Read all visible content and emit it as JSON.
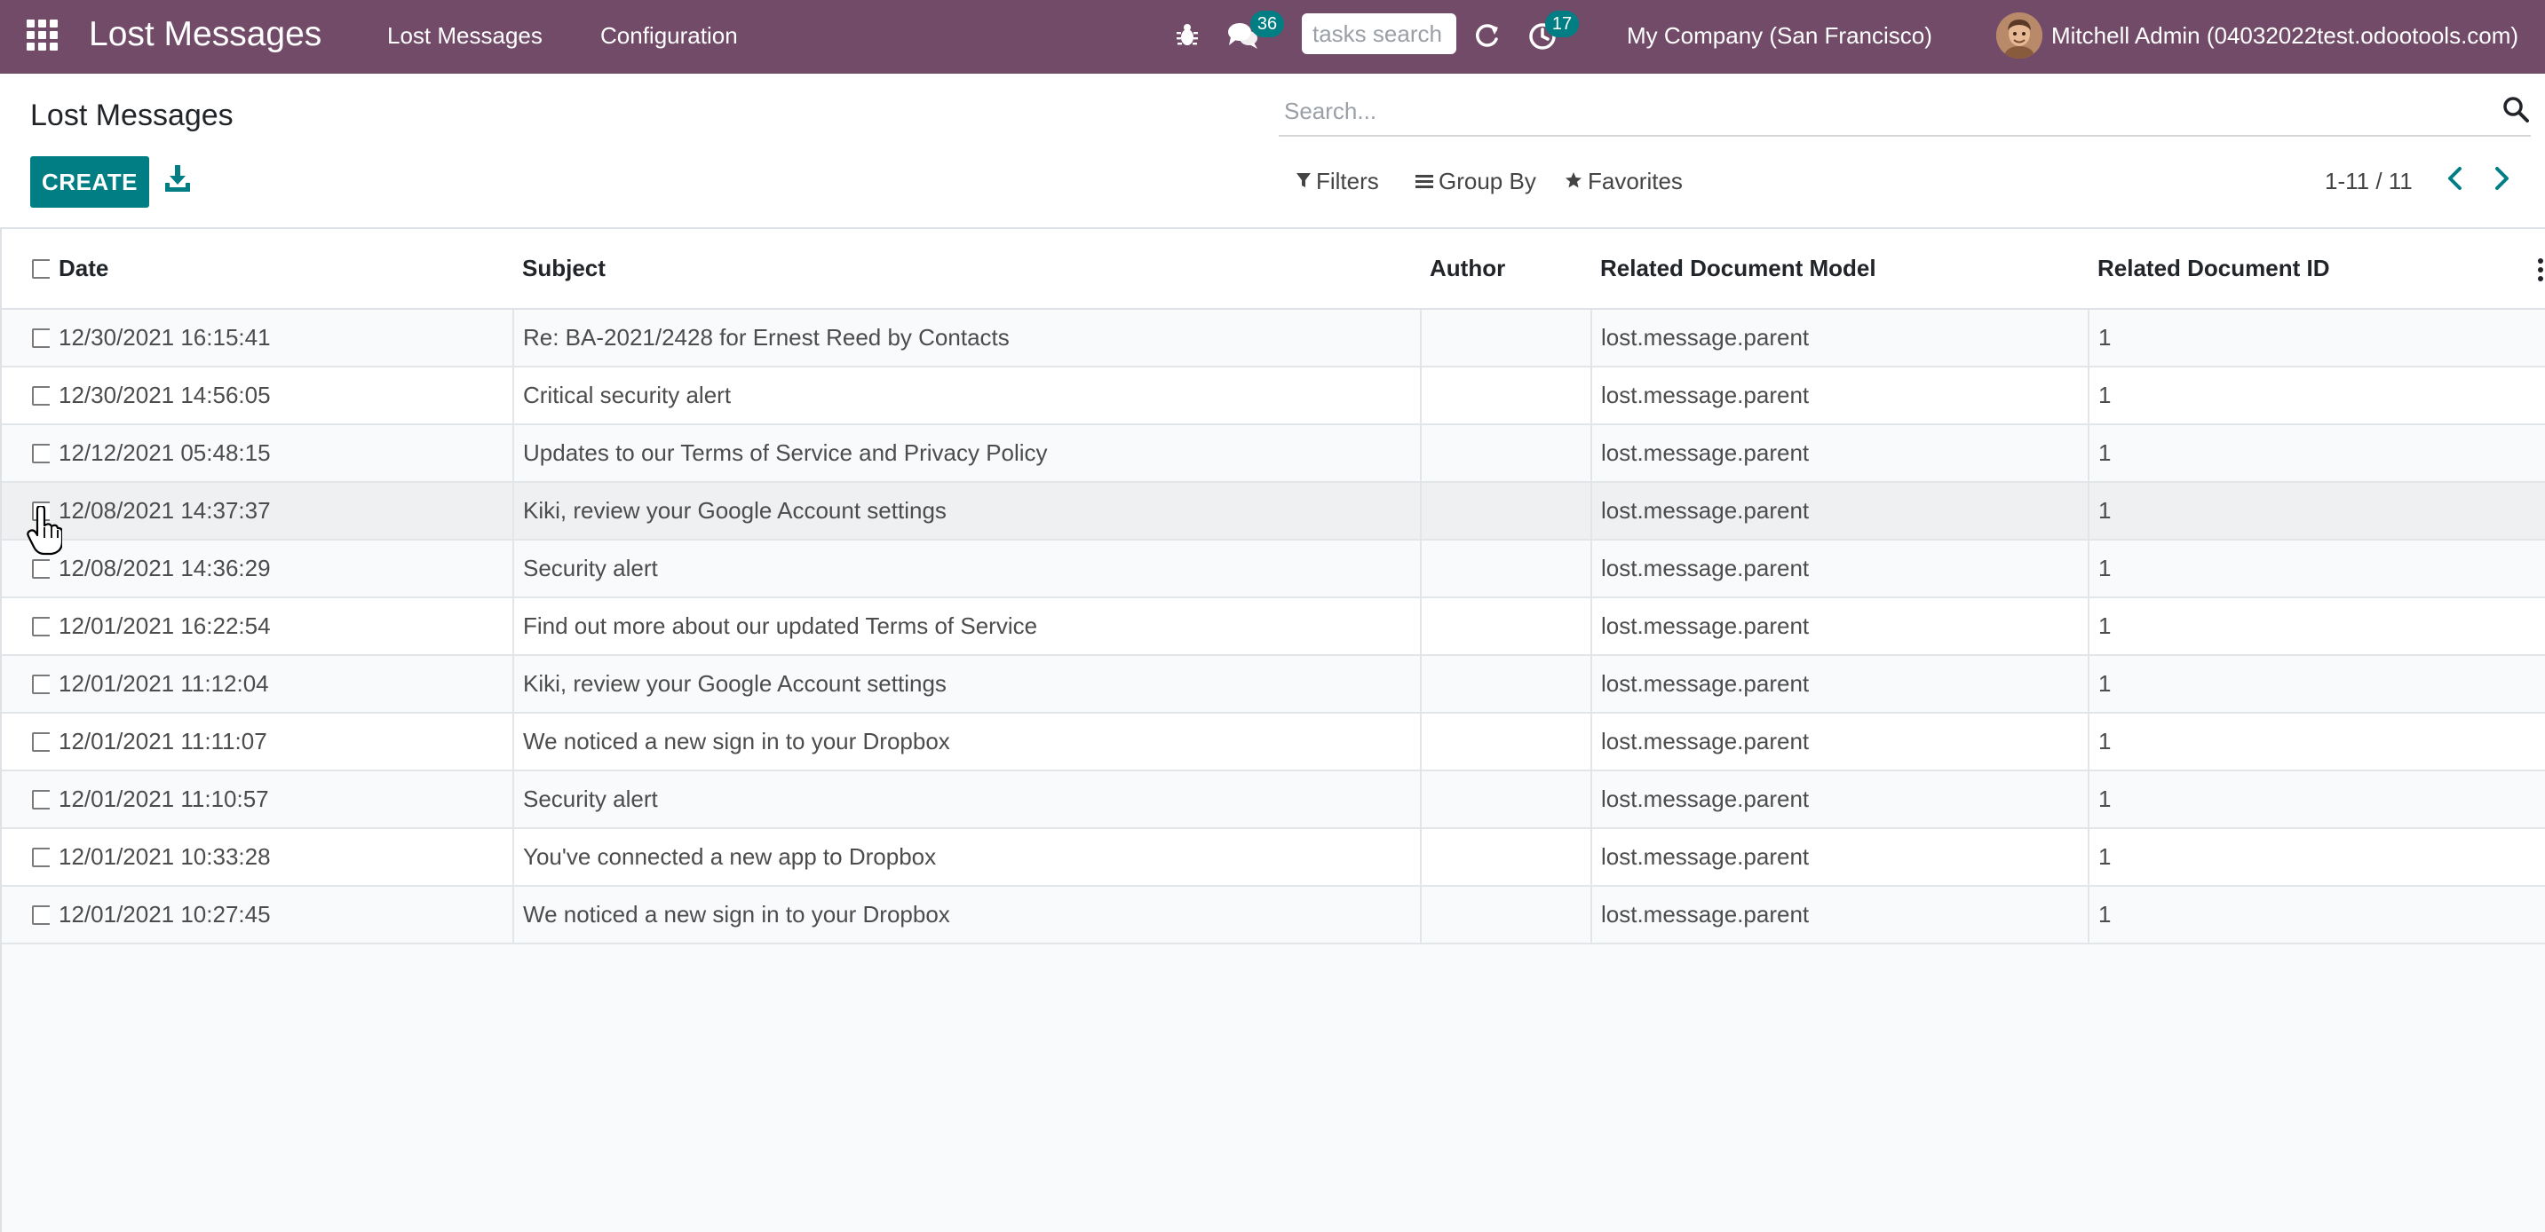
{
  "navbar": {
    "brand": "Lost Messages",
    "menu": [
      {
        "label": "Lost Messages"
      },
      {
        "label": "Configuration"
      }
    ],
    "chat_count": "36",
    "activity_count": "17",
    "tasks_search_placeholder": "tasks search",
    "company": "My Company (San Francisco)",
    "user": "Mitchell Admin (04032022test.odootools.com)",
    "color": "#714B67"
  },
  "control_panel": {
    "title": "Lost Messages",
    "search_placeholder": "Search...",
    "create_label": "CREATE",
    "filters_label": "Filters",
    "groupby_label": "Group By",
    "favorites_label": "Favorites",
    "pager": "1-11 / 11",
    "accent": "#017e84"
  },
  "table": {
    "columns": {
      "date": "Date",
      "subject": "Subject",
      "author": "Author",
      "model": "Related Document Model",
      "doc_id": "Related Document ID"
    },
    "rows": [
      {
        "date": "12/30/2021 16:15:41",
        "subject": "Re: BA-2021/2428 for Ernest Reed by Contacts",
        "author": "",
        "model": "lost.message.parent",
        "doc_id": "1"
      },
      {
        "date": "12/30/2021 14:56:05",
        "subject": "Critical security alert",
        "author": "",
        "model": "lost.message.parent",
        "doc_id": "1"
      },
      {
        "date": "12/12/2021 05:48:15",
        "subject": "Updates to our Terms of Service and Privacy Policy",
        "author": "",
        "model": "lost.message.parent",
        "doc_id": "1"
      },
      {
        "date": "12/08/2021 14:37:37",
        "subject": "Kiki, review your Google Account settings",
        "author": "",
        "model": "lost.message.parent",
        "doc_id": "1"
      },
      {
        "date": "12/08/2021 14:36:29",
        "subject": "Security alert",
        "author": "",
        "model": "lost.message.parent",
        "doc_id": "1"
      },
      {
        "date": "12/01/2021 16:22:54",
        "subject": "Find out more about our updated Terms of Service",
        "author": "",
        "model": "lost.message.parent",
        "doc_id": "1"
      },
      {
        "date": "12/01/2021 11:12:04",
        "subject": "Kiki, review your Google Account settings",
        "author": "",
        "model": "lost.message.parent",
        "doc_id": "1"
      },
      {
        "date": "12/01/2021 11:11:07",
        "subject": "We noticed a new sign in to your Dropbox",
        "author": "",
        "model": "lost.message.parent",
        "doc_id": "1"
      },
      {
        "date": "12/01/2021 11:10:57",
        "subject": "Security alert",
        "author": "",
        "model": "lost.message.parent",
        "doc_id": "1"
      },
      {
        "date": "12/01/2021 10:33:28",
        "subject": "You've connected a new app to Dropbox",
        "author": "",
        "model": "lost.message.parent",
        "doc_id": "1"
      },
      {
        "date": "12/01/2021 10:27:45",
        "subject": "We noticed a new sign in to your Dropbox",
        "author": "",
        "model": "lost.message.parent",
        "doc_id": "1"
      }
    ]
  },
  "icons": {
    "apps": "apps-grid-icon",
    "bug": "bug-icon",
    "chat": "chat-icon",
    "refresh": "refresh-icon",
    "activity": "clock-icon",
    "search": "search-icon",
    "download": "download-icon",
    "filter": "funnel-icon",
    "groupby": "list-icon",
    "favorites": "star-icon",
    "pager_prev": "chevron-left-icon",
    "pager_next": "chevron-right-icon",
    "optional_columns": "kebab-icon"
  }
}
